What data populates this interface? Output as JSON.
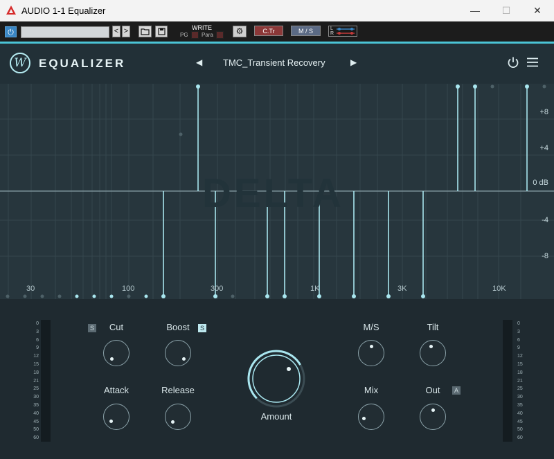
{
  "window": {
    "title": "AUDIO 1-1 Equalizer",
    "minimize": "—",
    "maximize": "☐",
    "close": "✕"
  },
  "hostbar": {
    "write": "WRITE",
    "pg": "PG",
    "para": "Para",
    "ctr": "C.Tr",
    "ms": "M / S",
    "l": "L",
    "r": "R",
    "prev": "<",
    "next": ">"
  },
  "plugin": {
    "brand": "EQUALIZER",
    "logo": "W",
    "preset_name": "TMC_Transient Recovery",
    "preset_prev": "◀",
    "preset_next": "▶",
    "watermark": "DELTA"
  },
  "graph": {
    "db_labels": [
      "+8",
      "+4",
      "0 dB",
      "-4",
      "-8"
    ],
    "freq_labels": [
      "30",
      "100",
      "300",
      "1K",
      "3K",
      "10K"
    ],
    "accent_color": "#a9e6ef"
  },
  "controls": {
    "cut": "Cut",
    "boost": "Boost",
    "attack": "Attack",
    "release": "Release",
    "amount": "Amount",
    "ms": "M/S",
    "tilt": "Tilt",
    "mix": "Mix",
    "out": "Out",
    "badge_s1": "S",
    "badge_s2": "S",
    "badge_a": "A"
  },
  "meter_scale": [
    "0",
    "3",
    "6",
    "9",
    "12",
    "15",
    "18",
    "21",
    "25",
    "30",
    "35",
    "40",
    "45",
    "50",
    "60"
  ]
}
